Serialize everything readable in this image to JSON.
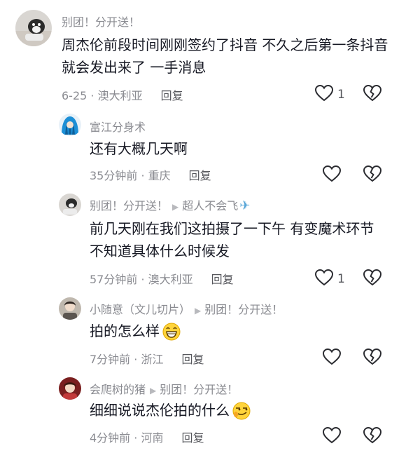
{
  "comments": [
    {
      "author": "别团！分开送！",
      "content": "周杰伦前段时间刚刚签约了抖音 不久之后第一条抖音就会发出来了 一手消息",
      "time": "6-25",
      "location": "澳大利亚",
      "reply_label": "回复",
      "like_count": "1"
    },
    {
      "author": "富江分身术",
      "content": "还有大概几天啊",
      "time": "35分钟前",
      "location": "重庆",
      "reply_label": "回复",
      "like_count": ""
    },
    {
      "author": "别团！分开送！",
      "reply_to": "超人不会飞",
      "content": "前几天刚在我们这拍摄了一下午 有变魔术环节 不知道具体什么时候发",
      "time": "57分钟前",
      "location": "澳大利亚",
      "reply_label": "回复",
      "like_count": "1"
    },
    {
      "author": "小随意（文儿切片）",
      "reply_to": "别团！分开送！",
      "content": "拍的怎么样",
      "time": "7分钟前",
      "location": "浙江",
      "reply_label": "回复",
      "like_count": ""
    },
    {
      "author": "会爬树的猪",
      "reply_to": "别团！分开送！",
      "content": "细细说说杰伦拍的什么",
      "time": "4分钟前",
      "location": "河南",
      "reply_label": "回复",
      "like_count": ""
    }
  ],
  "icons": {
    "reply_arrow": "right-triangle-icon",
    "plane": "airplane-icon",
    "like": "heart-outline-icon",
    "dislike": "broken-heart-icon",
    "grin": "grinning-emoji-icon",
    "smirk": "smirk-emoji-icon"
  },
  "separator": " · "
}
